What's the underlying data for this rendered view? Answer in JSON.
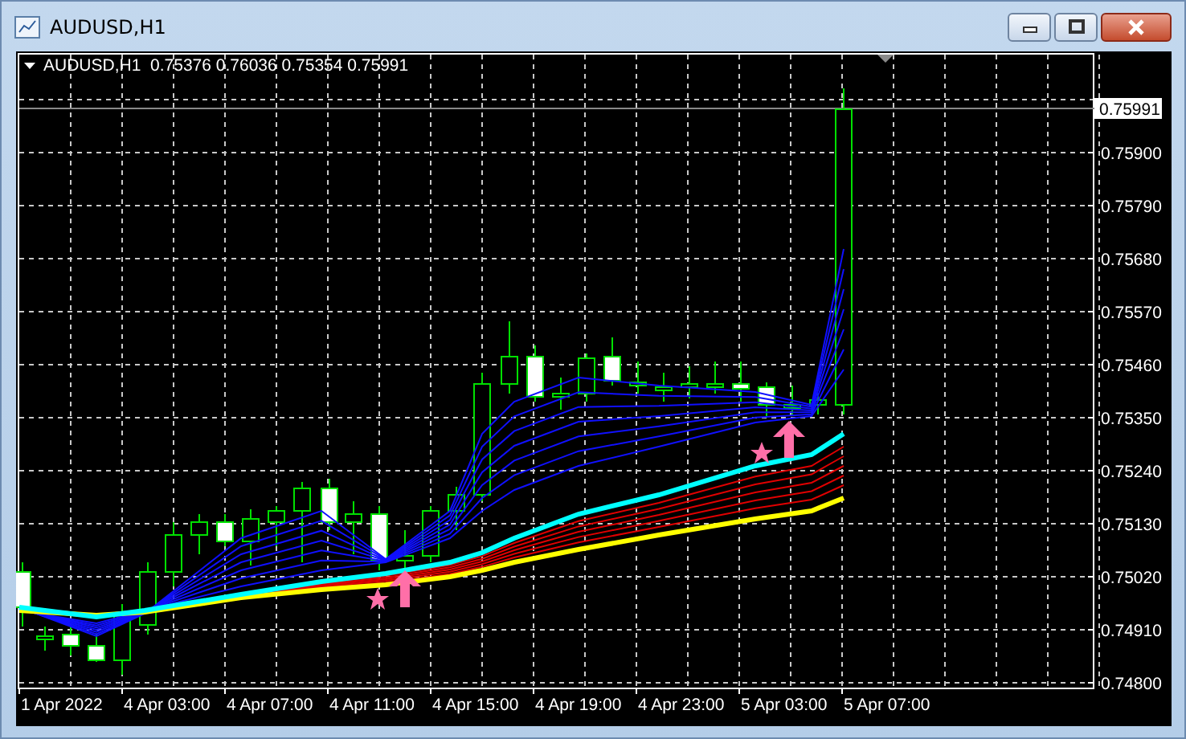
{
  "window": {
    "title": "AUDUSD,H1"
  },
  "chart": {
    "header": "AUDUSD,H1  0.75376 0.76036 0.75354 0.75991",
    "current_price": "0.75991",
    "price_labels": [
      "0.75900",
      "0.75790",
      "0.75680",
      "0.75570",
      "0.75460",
      "0.75350",
      "0.75240",
      "0.75130",
      "0.75020",
      "0.74910",
      "0.74800"
    ],
    "time_labels": [
      "1 Apr 2022",
      "4 Apr 03:00",
      "4 Apr 07:00",
      "4 Apr 11:00",
      "4 Apr 15:00",
      "4 Apr 19:00",
      "4 Apr 23:00",
      "5 Apr 03:00",
      "5 Apr 07:00"
    ]
  }
}
